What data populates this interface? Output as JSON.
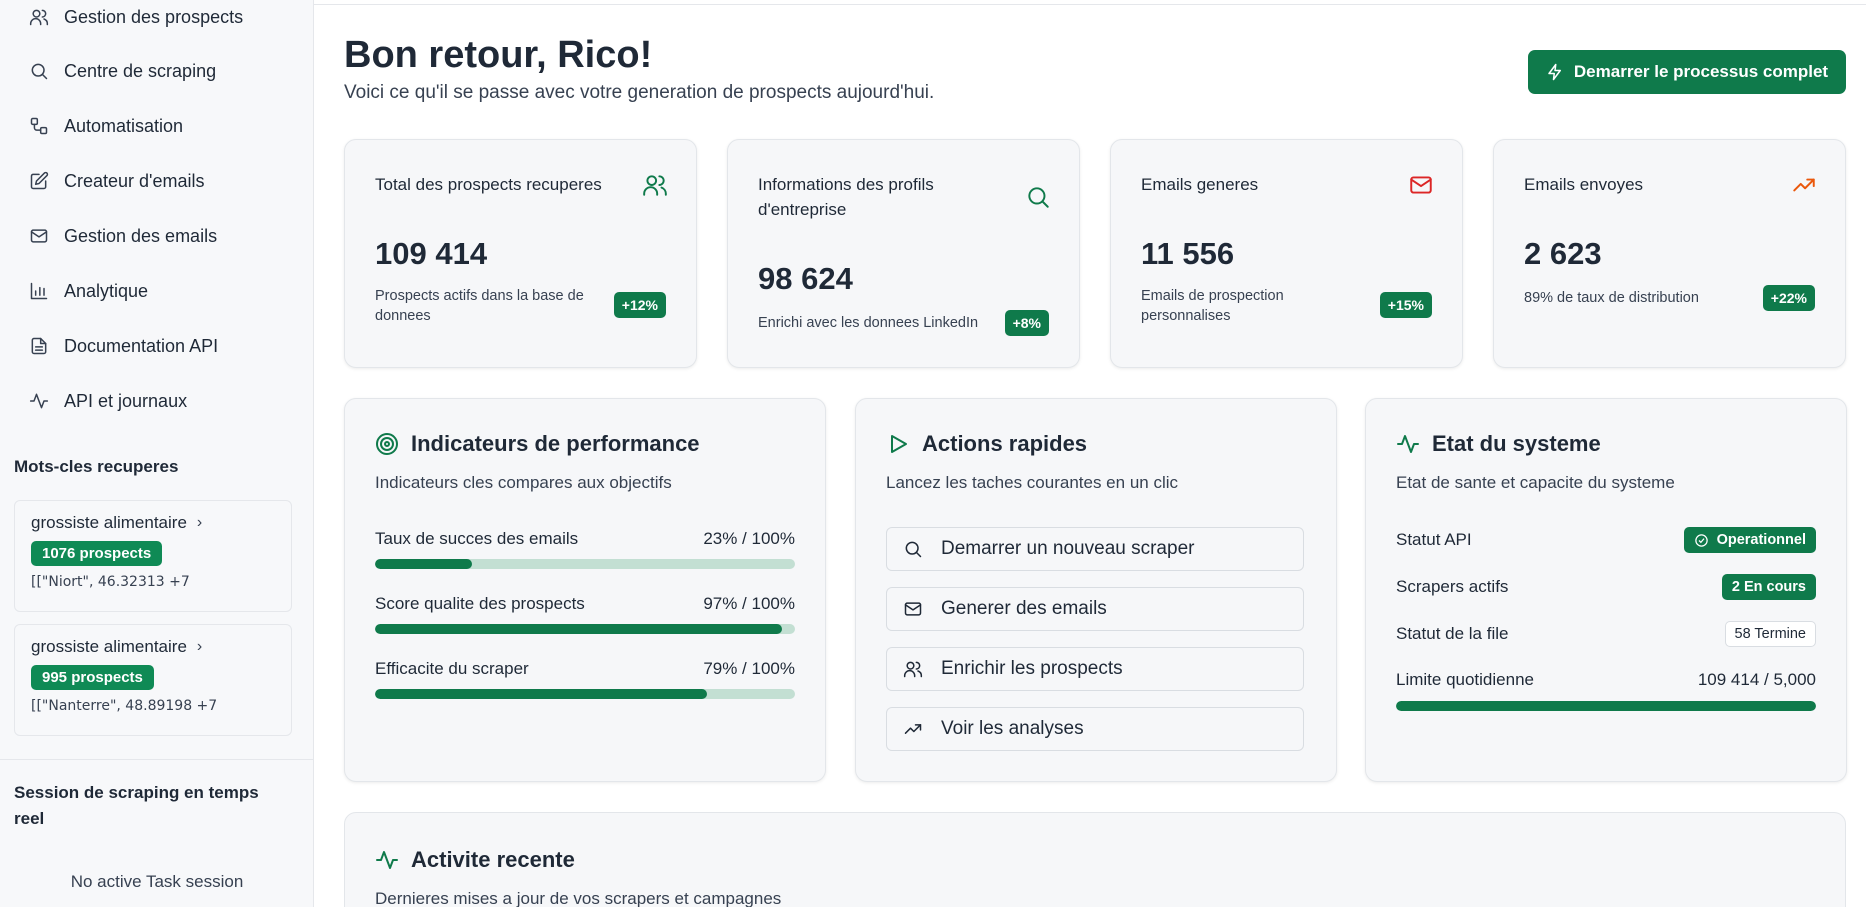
{
  "sidebar": {
    "nav": [
      {
        "label": "Gestion des prospects",
        "icon": "users-icon"
      },
      {
        "label": "Centre de scraping",
        "icon": "search-icon"
      },
      {
        "label": "Automatisation",
        "icon": "workflow-icon"
      },
      {
        "label": "Createur d'emails",
        "icon": "edit-icon"
      },
      {
        "label": "Gestion des emails",
        "icon": "mail-icon"
      },
      {
        "label": "Analytique",
        "icon": "bar-chart-icon"
      },
      {
        "label": "Documentation API",
        "icon": "document-icon"
      },
      {
        "label": "API et journaux",
        "icon": "activity-icon"
      }
    ],
    "keywords_title": "Mots-cles recuperes",
    "keywords": [
      {
        "title": "grossiste alimentaire",
        "badge": "1076 prospects",
        "coords": "[[\"Niort\", 46.32313 +7"
      },
      {
        "title": "grossiste alimentaire",
        "badge": "995 prospects",
        "coords": "[[\"Nanterre\", 48.89198 +7"
      }
    ],
    "session_title": "Session de scraping en temps reel",
    "session_empty": "No active Task session"
  },
  "header": {
    "title": "Bon retour, Rico!",
    "subtitle": "Voici ce qu'il se passe avec votre generation de prospects aujourd'hui.",
    "cta": "Demarrer le processus complet"
  },
  "stats": [
    {
      "label": "Total des prospects recuperes",
      "value": "109 414",
      "desc": "Prospects actifs dans la base de donnees",
      "badge": "+12%",
      "icon": "users-icon",
      "color": "#0f7a4b"
    },
    {
      "label": "Informations des profils d'entreprise",
      "value": "98 624",
      "desc": "Enrichi avec les donnees LinkedIn",
      "badge": "+8%",
      "icon": "search-icon",
      "color": "#0f7a4b"
    },
    {
      "label": "Emails generes",
      "value": "11 556",
      "desc": "Emails de prospection personnalises",
      "badge": "+15%",
      "icon": "mail-icon",
      "color": "#dc2626"
    },
    {
      "label": "Emails envoyes",
      "value": "2 623",
      "desc": "89% de taux de distribution",
      "badge": "+22%",
      "icon": "trending-up-icon",
      "color": "#ea580c"
    }
  ],
  "performance": {
    "title": "Indicateurs de performance",
    "subtitle": "Indicateurs cles compares aux objectifs",
    "metrics": [
      {
        "label": "Taux de succes des emails",
        "value_text": "23% / 100%",
        "percent": 23
      },
      {
        "label": "Score qualite des prospects",
        "value_text": "97% / 100%",
        "percent": 97
      },
      {
        "label": "Efficacite du scraper",
        "value_text": "79% / 100%",
        "percent": 79
      }
    ]
  },
  "quick_actions": {
    "title": "Actions rapides",
    "subtitle": "Lancez les taches courantes en un clic",
    "items": [
      {
        "label": "Demarrer un nouveau scraper",
        "icon": "search-icon"
      },
      {
        "label": "Generer des emails",
        "icon": "mail-icon"
      },
      {
        "label": "Enrichir les prospects",
        "icon": "users-icon"
      },
      {
        "label": "Voir les analyses",
        "icon": "trending-up-icon"
      }
    ]
  },
  "system": {
    "title": "Etat du systeme",
    "subtitle": "Etat de sante et capacite du systeme",
    "rows": [
      {
        "label": "Statut API",
        "value": "Operationnel"
      },
      {
        "label": "Scrapers actifs",
        "value": "2 En cours"
      },
      {
        "label": "Statut de la file",
        "value": "58 Termine"
      },
      {
        "label": "Limite quotidienne",
        "value": "109 414 / 5,000"
      }
    ],
    "daily_limit_fill": 100
  },
  "activity": {
    "title": "Activite recente",
    "subtitle": "Dernieres mises a jour de vos scrapers et campagnes"
  }
}
